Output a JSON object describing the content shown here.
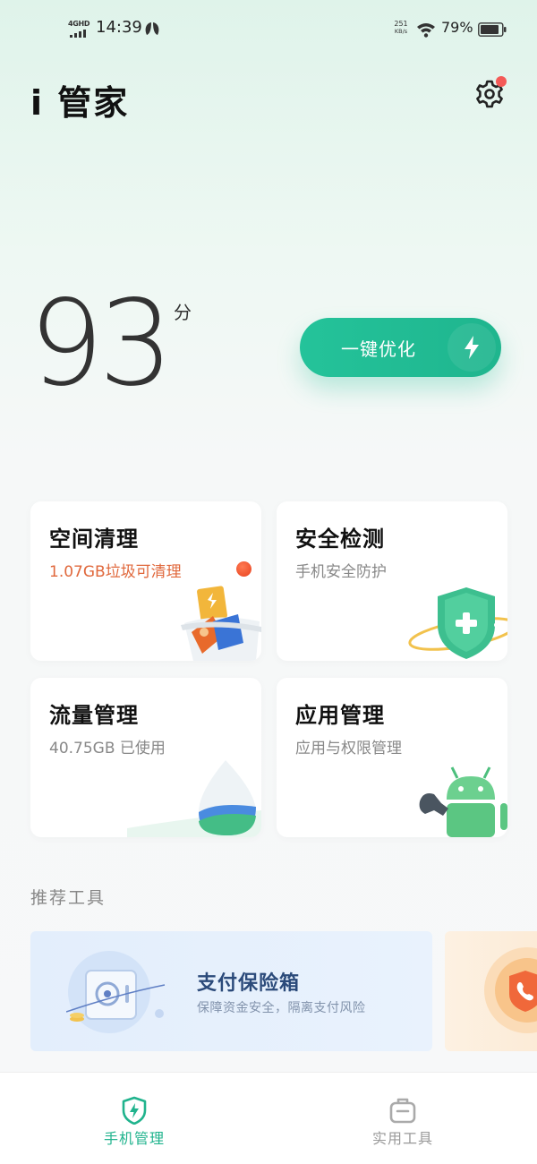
{
  "status_bar": {
    "network_type": "4GHD",
    "time": "14:39",
    "speed_value": "251",
    "speed_unit": "KB/s",
    "battery_percent": "79%"
  },
  "header": {
    "title": "i 管家",
    "settings_icon": "gear-icon",
    "settings_has_badge": true
  },
  "score": {
    "value": "93",
    "unit": "分"
  },
  "optimize_button": {
    "label": "一键优化",
    "icon": "lightning-icon"
  },
  "feature_cards": [
    {
      "title": "空间清理",
      "subtitle": "1.07GB垃圾可清理",
      "subtitle_color": "#e0683c",
      "icon": "trash-bin-icon"
    },
    {
      "title": "安全检测",
      "subtitle": "手机安全防护",
      "subtitle_color": "#888888",
      "icon": "shield-plus-icon"
    },
    {
      "title": "流量管理",
      "subtitle": "40.75GB 已使用",
      "subtitle_color": "#888888",
      "icon": "water-drop-icon"
    },
    {
      "title": "应用管理",
      "subtitle": "应用与权限管理",
      "subtitle_color": "#888888",
      "icon": "android-robot-icon"
    }
  ],
  "recommended": {
    "section_title": "推荐工具",
    "tools": [
      {
        "title": "支付保险箱",
        "subtitle": "保障资金安全，隔离支付风险",
        "icon": "safe-box-icon"
      },
      {
        "title": "",
        "subtitle": "",
        "icon": "phone-shield-icon"
      }
    ]
  },
  "bottom_nav": {
    "items": [
      {
        "label": "手机管理",
        "icon": "phone-manage-shield-icon",
        "active": true
      },
      {
        "label": "实用工具",
        "icon": "toolbox-icon",
        "active": false
      }
    ]
  },
  "colors": {
    "accent": "#20b38d",
    "warning": "#e0683c",
    "badge": "#f45a57"
  }
}
